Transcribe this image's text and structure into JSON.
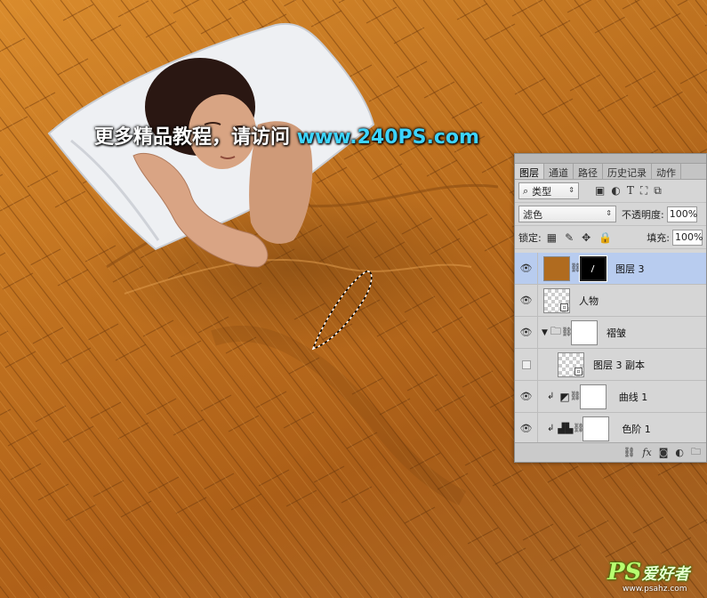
{
  "watermark": {
    "prefix": "更多精品教程，请访问",
    "url": "www.240PS.com"
  },
  "logo": {
    "ps": "PS",
    "cn": "爱好者",
    "url": "www.psahz.com"
  },
  "layers_panel": {
    "tabs": [
      {
        "label": "图层",
        "active": true
      },
      {
        "label": "通道",
        "active": false
      },
      {
        "label": "路径",
        "active": false
      },
      {
        "label": "历史记录",
        "active": false
      },
      {
        "label": "动作",
        "active": false
      }
    ],
    "filter_kind": "类型",
    "filter_icons": [
      "image-filter-icon",
      "adjustment-filter-icon",
      "type-filter-icon",
      "shape-filter-icon",
      "smart-object-filter-icon"
    ],
    "blend_mode": "滤色",
    "opacity_label": "不透明度:",
    "opacity_value": "100%",
    "lock_label": "锁定:",
    "fill_label": "填充:",
    "fill_value": "100%",
    "layers": [
      {
        "name": "图层 3",
        "visible": true,
        "selected": true,
        "thumb": "brown",
        "mask": "black"
      },
      {
        "name": "人物",
        "visible": true,
        "selected": false,
        "thumb": "checker-smart"
      },
      {
        "name": "褶皱",
        "visible": true,
        "selected": false,
        "thumb": "folder",
        "mask": "white"
      },
      {
        "name": "图层 3 副本",
        "visible": false,
        "selected": false,
        "thumb": "checker-smart"
      },
      {
        "name": "曲线 1",
        "visible": true,
        "selected": false,
        "thumb": "curves",
        "mask": "white"
      },
      {
        "name": "色阶 1",
        "visible": true,
        "selected": false,
        "thumb": "levels",
        "mask": "white"
      }
    ],
    "bottom_icons": [
      "link-icon",
      "fx-icon",
      "mask-icon",
      "adjustment-icon",
      "folder-icon"
    ]
  },
  "colors": {
    "panel_bg": "#d6d6d6",
    "selected_row": "#b8ccef",
    "wood_mid": "#c57420",
    "url_accent": "#3cd4ff"
  }
}
